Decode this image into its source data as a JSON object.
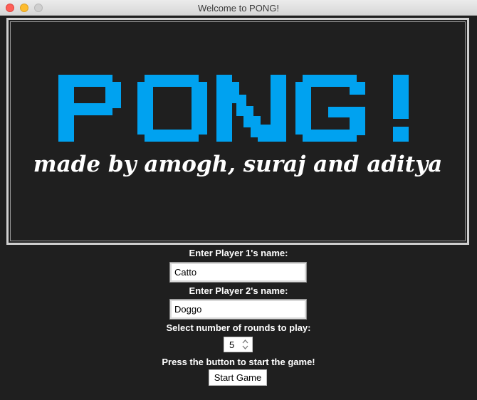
{
  "window": {
    "title": "Welcome to PONG!"
  },
  "banner": {
    "logo_text": "PONG!",
    "subtitle": "made by amogh, suraj and aditya",
    "logo_color": "#00a2f0"
  },
  "form": {
    "player1_label": "Enter Player 1's name:",
    "player1_value": "Catto",
    "player2_label": "Enter Player 2's name:",
    "player2_value": "Doggo",
    "rounds_label": "Select number of rounds to play:",
    "rounds_value": "5",
    "start_prompt": "Press the button to start the game!",
    "start_button": "Start Game"
  },
  "colors": {
    "background": "#1f1f1f",
    "text": "#ffffff"
  }
}
